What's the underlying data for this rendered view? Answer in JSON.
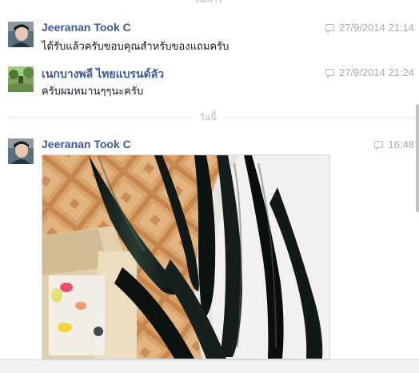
{
  "separators": {
    "top": "วันเสาร์",
    "today": "วันนี้"
  },
  "messages": [
    {
      "sender": "Jeeranan Took C",
      "time": "27/9/2014 21:14",
      "text": "ได้รับแล้วครับขอบคุณสำหรับของแถมครับ"
    },
    {
      "sender": "เนกบางพลี ไทยแบรนด์ลัว",
      "time": "27/9/2014 21:24",
      "text": "ครับผมหมานๆๆนะครับ"
    },
    {
      "sender": "Jeeranan Took C",
      "time": "16:48",
      "attachment": "photo"
    }
  ],
  "icons": {
    "timestamp": "chat-bubble-icon"
  },
  "colors": {
    "sender_name": "#3b5998",
    "timestamp": "#a7aab0",
    "separator": "#b4b7bd"
  }
}
